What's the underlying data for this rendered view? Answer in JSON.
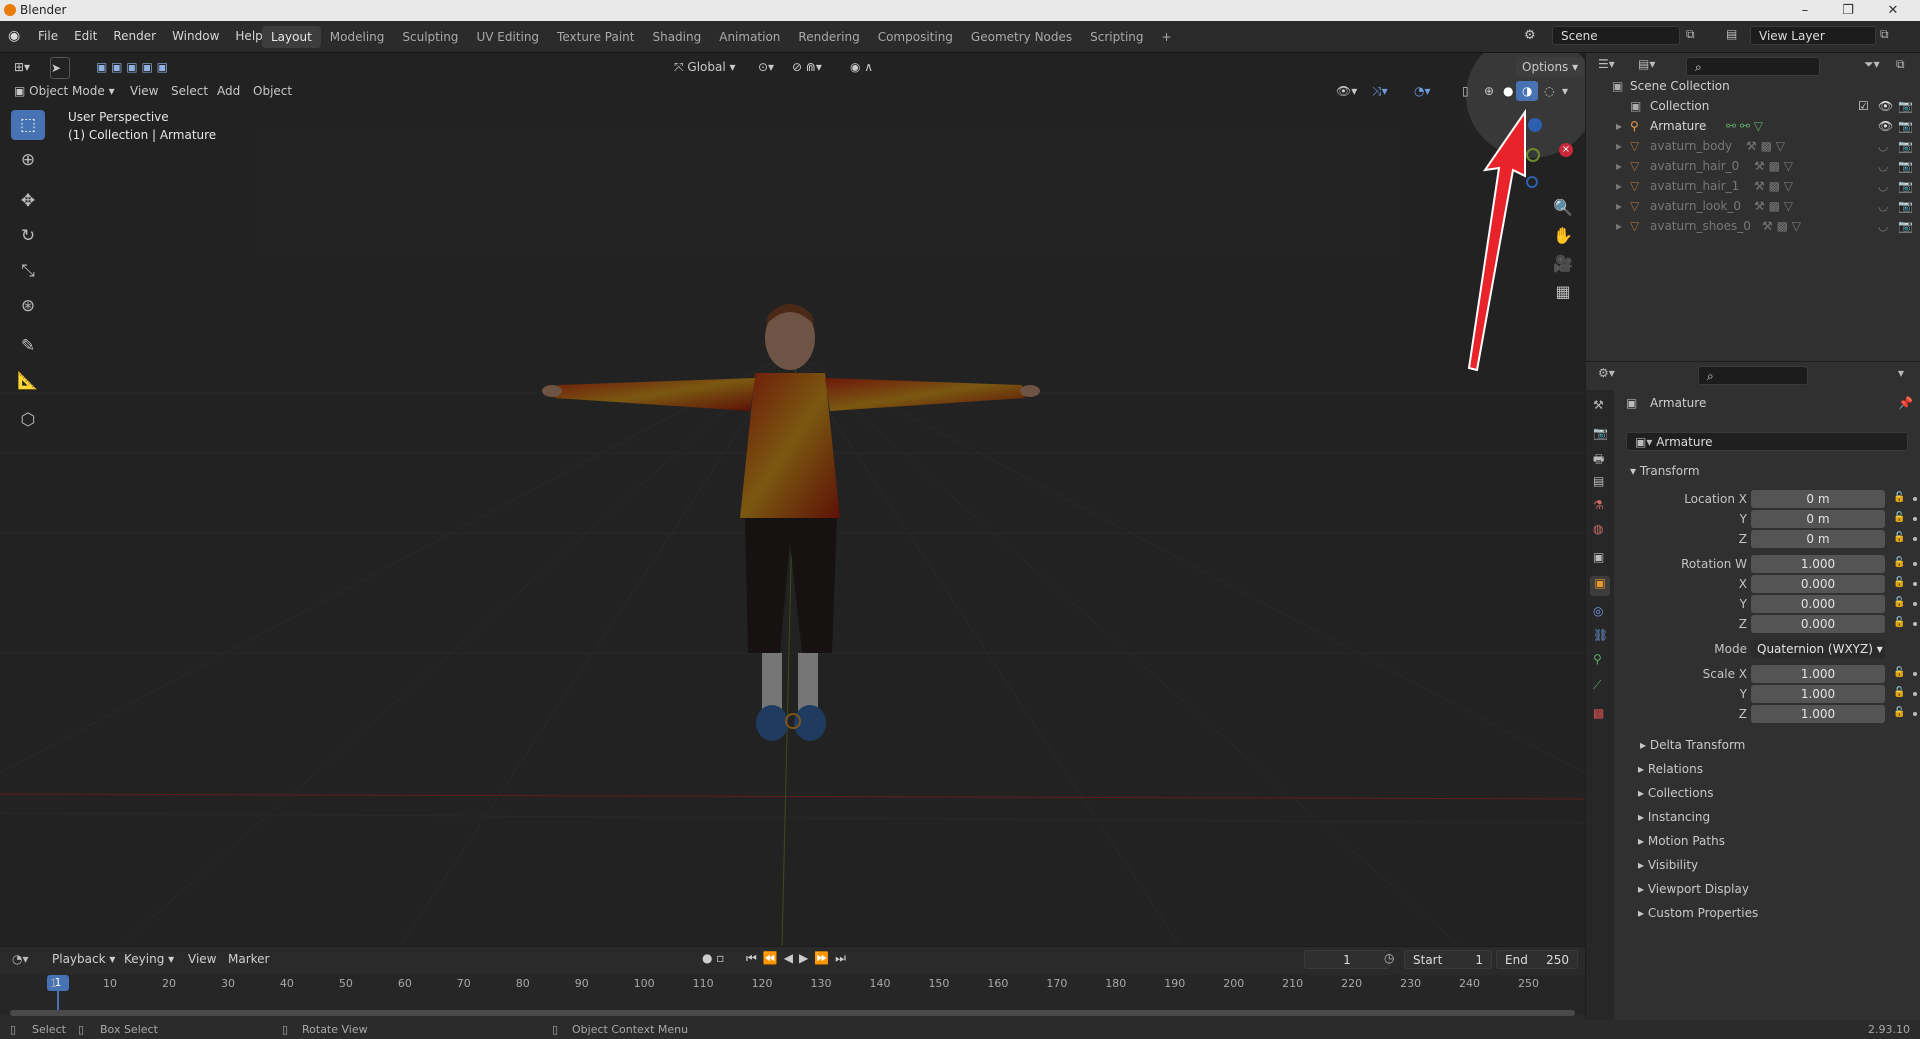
{
  "window": {
    "title": "Blender",
    "version": "2.93.10"
  },
  "menubar": [
    "File",
    "Edit",
    "Render",
    "Window",
    "Help"
  ],
  "workspaces": [
    {
      "label": "Layout",
      "active": true
    },
    {
      "label": "Modeling"
    },
    {
      "label": "Sculpting"
    },
    {
      "label": "UV Editing"
    },
    {
      "label": "Texture Paint"
    },
    {
      "label": "Shading"
    },
    {
      "label": "Animation"
    },
    {
      "label": "Rendering"
    },
    {
      "label": "Compositing"
    },
    {
      "label": "Geometry Nodes"
    },
    {
      "label": "Scripting"
    },
    {
      "label": "+"
    }
  ],
  "scene": {
    "scene_name": "Scene",
    "view_layer": "View Layer"
  },
  "viewport_header": {
    "mode": "Object Mode",
    "menus": [
      "View",
      "Select",
      "Add",
      "Object"
    ],
    "orientation": "Global",
    "options": "Options"
  },
  "viewport_info": {
    "line1": "User Perspective",
    "line2": "(1) Collection | Armature"
  },
  "outliner": {
    "root": "Scene Collection",
    "collection": "Collection",
    "items": [
      "Armature",
      "avaturn_body",
      "avaturn_hair_0",
      "avaturn_hair_1",
      "avaturn_look_0",
      "avaturn_shoes_0"
    ]
  },
  "properties": {
    "object_name": "Armature",
    "data_name": "Armature",
    "transform_title": "Transform",
    "location": {
      "label": "Location X",
      "x": "0 m",
      "y": "0 m",
      "z": "0 m"
    },
    "rotation": {
      "label": "Rotation W",
      "w": "1.000",
      "x": "0.000",
      "y": "0.000",
      "z": "0.000"
    },
    "mode_label": "Mode",
    "mode_value": "Quaternion (WXYZ)",
    "scale": {
      "label": "Scale X",
      "x": "1.000",
      "y": "1.000",
      "z": "1.000"
    },
    "axis_labels": {
      "x": "X",
      "y": "Y",
      "z": "Z"
    },
    "delta": "Delta Transform",
    "sections": [
      "Relations",
      "Collections",
      "Instancing",
      "Motion Paths",
      "Visibility",
      "Viewport Display",
      "Custom Properties"
    ]
  },
  "timeline": {
    "menus": [
      "Playback",
      "Keying",
      "View",
      "Marker"
    ],
    "current_frame": "1",
    "start_label": "Start",
    "start": "1",
    "end_label": "End",
    "end": "250",
    "ticks": [
      "1",
      "10",
      "20",
      "30",
      "40",
      "50",
      "60",
      "70",
      "80",
      "90",
      "100",
      "110",
      "120",
      "130",
      "140",
      "150",
      "160",
      "170",
      "180",
      "190",
      "200",
      "210",
      "220",
      "230",
      "240",
      "250"
    ]
  },
  "statusbar": {
    "select": "Select",
    "box_select": "Box Select",
    "rotate": "Rotate View",
    "context": "Object Context Menu"
  },
  "colors": {
    "accent": "#4772b3",
    "arrow": "#e8232a",
    "x_axis": "#d6333f",
    "y_axis": "#7aa82a",
    "z_axis": "#3a6bbf"
  }
}
